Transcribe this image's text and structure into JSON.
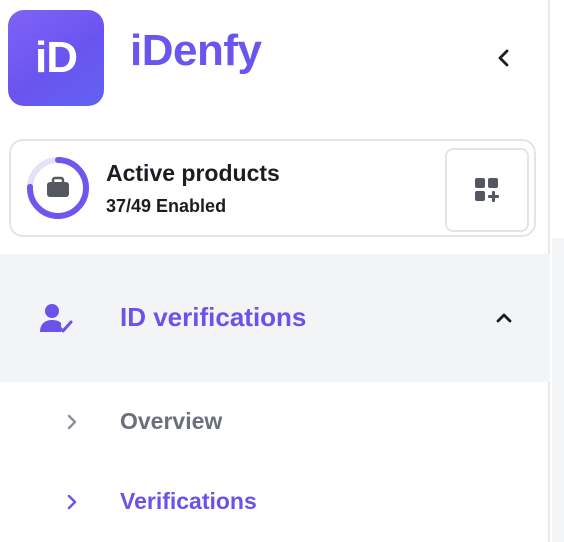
{
  "header": {
    "logo_tile_text": "iD",
    "brand_name": "iDenfy",
    "collapse_icon": "chevron-left-icon"
  },
  "products": {
    "title": "Active products",
    "count_text": "37/49 Enabled",
    "enabled": 37,
    "total": 49,
    "progress_fraction": 0.755,
    "ring_icon": "briefcase-icon",
    "add_button_icon": "add-grid-icon"
  },
  "nav": {
    "section": {
      "label": "ID verifications",
      "icon": "user-check-icon",
      "expanded": true,
      "chevron_icon": "chevron-up-icon"
    },
    "items": [
      {
        "label": "Overview",
        "active": false,
        "icon": "chevron-right-icon"
      },
      {
        "label": "Verifications",
        "active": true,
        "icon": "chevron-right-icon"
      }
    ]
  },
  "colors": {
    "brand": "#6a55ef",
    "active_text": "#6c52ea",
    "muted_text": "#6a6f7c",
    "section_bg": "#f3f4f6",
    "ring_track": "#e4e1fb"
  }
}
